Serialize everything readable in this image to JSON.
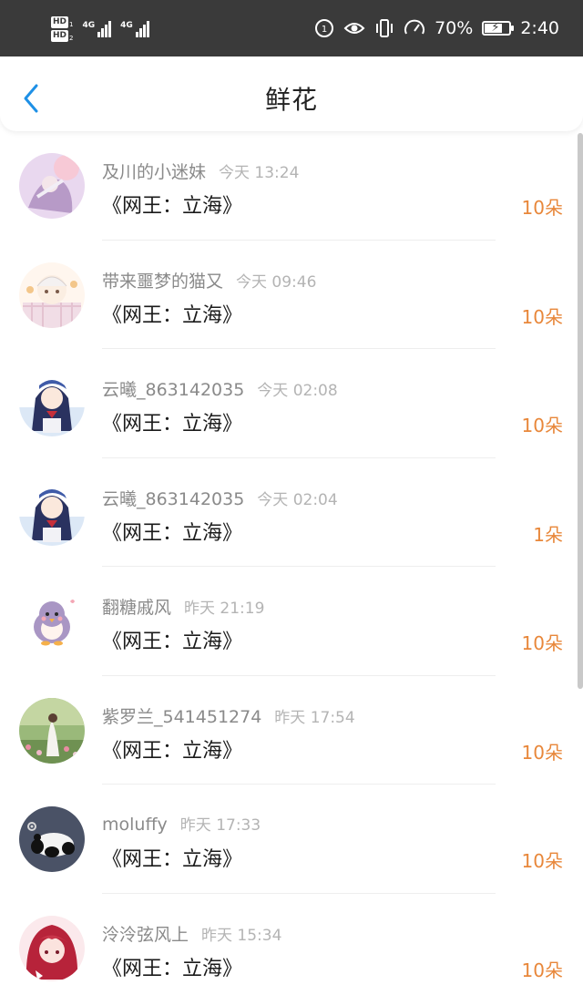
{
  "status_bar": {
    "hd1_label": "HD",
    "hd1_sub": "1",
    "hd2_label": "HD",
    "hd2_sub": "2",
    "signal1_label": "4G",
    "signal2_label": "4G",
    "battery_percent": "70%",
    "battery_level": 0.7,
    "time": "2:40",
    "icons": [
      "hd-icon",
      "signal-icon",
      "data-saver-icon",
      "eye-comfort-icon",
      "vibrate-icon",
      "speed-icon",
      "battery-icon"
    ]
  },
  "header": {
    "title": "鲜花",
    "back_icon": "chevron-left-icon",
    "accent_color": "#1e90e6"
  },
  "list": {
    "count_color": "#e8873a",
    "items": [
      {
        "user": "及川的小迷妹",
        "time": "今天 13:24",
        "book": "《网王：立海》",
        "count": "10朵",
        "avatar": "anime-girl-pink-avatar"
      },
      {
        "user": "带来噩梦的猫又",
        "time": "今天 09:46",
        "book": "《网王：立海》",
        "count": "10朵",
        "avatar": "chibi-boy-avatar"
      },
      {
        "user": "云曦_863142035",
        "time": "今天 02:08",
        "book": "《网王：立海》",
        "count": "10朵",
        "avatar": "anime-girl-blue-avatar"
      },
      {
        "user": "云曦_863142035",
        "time": "今天 02:04",
        "book": "《网王：立海》",
        "count": "1朵",
        "avatar": "anime-girl-blue-avatar"
      },
      {
        "user": "翻糖戚风",
        "time": "昨天 21:19",
        "book": "《网王：立海》",
        "count": "10朵",
        "avatar": "penguin-avatar"
      },
      {
        "user": "紫罗兰_541451274",
        "time": "昨天 17:54",
        "book": "《网王：立海》",
        "count": "10朵",
        "avatar": "flower-field-avatar"
      },
      {
        "user": "moluffy",
        "time": "昨天 17:33",
        "book": "《网王：立海》",
        "count": "10朵",
        "avatar": "panda-avatar"
      },
      {
        "user": "泠泠弦风上",
        "time": "昨天 15:34",
        "book": "《网王：立海》",
        "count": "10朵",
        "avatar": "red-hair-girl-avatar"
      }
    ]
  }
}
